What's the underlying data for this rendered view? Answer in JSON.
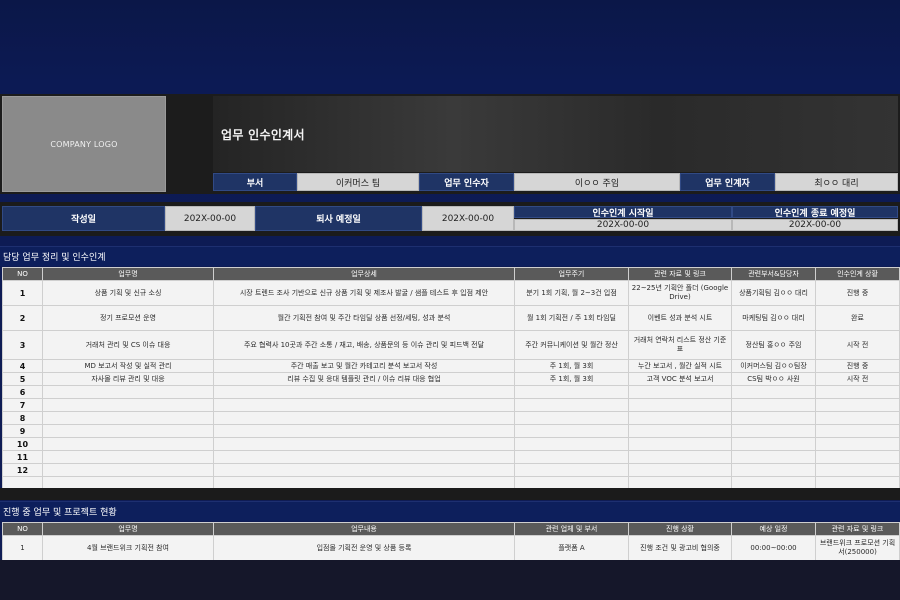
{
  "header": {
    "logo_text": "COMPANY LOGO",
    "title": "업무 인수인계서",
    "dept_label": "부서",
    "dept_value": "이커머스 팀",
    "receiver_label": "업무 인수자",
    "receiver_value": "이ㅇㅇ 주임",
    "giver_label": "업무 인계자",
    "giver_value": "최ㅇㅇ 대리"
  },
  "dates": {
    "written_label": "작성일",
    "written_value": "202X-00-00",
    "leave_label": "퇴사 예정일",
    "leave_value": "202X-00-00",
    "start_label": "인수인계 시작일",
    "start_value": "202X-00-00",
    "end_label": "인수인계 종료 예정일",
    "end_value": "202X-00-00"
  },
  "section1": {
    "title": "담당 업무 정리 및 인수인계",
    "columns": [
      "NO",
      "업무명",
      "업무상세",
      "업무주기",
      "관련 자료 및 링크",
      "관련부서&담당자",
      "인수인계 상황"
    ],
    "rows": [
      {
        "no": "1",
        "name": "상품 기획 및 신규 소싱",
        "detail": "시장 트렌드 조사 기반으로 신규 상품 기획 및 제조사 발굴 / 샘플 테스트 후 입점 제안",
        "cycle": "분기 1회 기획, 월 2~3건 입점",
        "ref": "22~25년 기획안 폴더 (Google Drive)",
        "owner": "상품기획팀 김ㅇㅇ 대리",
        "status": "진행 중"
      },
      {
        "no": "2",
        "name": "정기 프로모션 운영",
        "detail": "월간 기획전 참여 및 주간 타임딜 상품 선정/세팅, 성과 분석",
        "cycle": "월 1회 기획전 / 주 1회 타임딜",
        "ref": "이벤트 성과 분석 시트",
        "owner": "마케팅팀 김ㅇㅇ 대리",
        "status": "완료"
      },
      {
        "no": "3",
        "name": "거래처 관리 및 CS 이슈 대응",
        "detail": "주요 협력사 10곳과 주간 소통 / 재고, 배송, 상품문의 등 이슈 관리 및 피드백 전달",
        "cycle": "주간 커뮤니케이션 및 월간 정산",
        "ref": "거래처 연락처 리스트 정산 기준표",
        "owner": "정산팀 홍ㅇㅇ 주임",
        "status": "시작 전"
      },
      {
        "no": "4",
        "name": "MD 보고서 작성 및 실적 관리",
        "detail": "주간 매출 보고 및 월간 카테고리 분석 보고서 작성",
        "cycle": "주 1회, 월 3회",
        "ref": "누간 보고서 , 월간 실적 시트",
        "owner": "이커머스팀 김ㅇㅇ팀장",
        "status": "진행 중"
      },
      {
        "no": "5",
        "name": "자사몰 리뷰 관리 및 대응",
        "detail": "리뷰 수집 및 응대 템플릿 관리 / 이슈 리뷰 대응 협업",
        "cycle": "주 1회, 월 3회",
        "ref": "고객 VOC 분석 보고서",
        "owner": "CS팀 박ㅇㅇ 사원",
        "status": "시작 전"
      },
      {
        "no": "6",
        "name": "",
        "detail": "",
        "cycle": "",
        "ref": "",
        "owner": "",
        "status": ""
      },
      {
        "no": "7",
        "name": "",
        "detail": "",
        "cycle": "",
        "ref": "",
        "owner": "",
        "status": ""
      },
      {
        "no": "8",
        "name": "",
        "detail": "",
        "cycle": "",
        "ref": "",
        "owner": "",
        "status": ""
      },
      {
        "no": "9",
        "name": "",
        "detail": "",
        "cycle": "",
        "ref": "",
        "owner": "",
        "status": ""
      },
      {
        "no": "10",
        "name": "",
        "detail": "",
        "cycle": "",
        "ref": "",
        "owner": "",
        "status": ""
      },
      {
        "no": "11",
        "name": "",
        "detail": "",
        "cycle": "",
        "ref": "",
        "owner": "",
        "status": ""
      },
      {
        "no": "12",
        "name": "",
        "detail": "",
        "cycle": "",
        "ref": "",
        "owner": "",
        "status": ""
      }
    ]
  },
  "section2": {
    "title": "진행 중 업무 및 프로젝트 현황",
    "columns": [
      "NO",
      "업무명",
      "업무내용",
      "관련 업체 및 부서",
      "진행 상황",
      "예상 일정",
      "관련 자료 및 링크"
    ],
    "rows": [
      {
        "no": "1",
        "name": "4월 브랜드위크 기획전 참여",
        "detail": "입점몰 기획전 운영 및 상품 등록",
        "partner": "플랫폼 A",
        "progress": "진행 조건 및 광고비 협의중",
        "schedule": "00:00~00:00",
        "ref": "브랜드위크 프로모션 기획서(250000)"
      }
    ]
  },
  "colors": {
    "background": "#0c1a54",
    "navy_cell": "#1f3465",
    "gray_cell": "#d6d6d6",
    "table_header": "#5a5a5a",
    "section_bar": "#0d1f5c"
  }
}
